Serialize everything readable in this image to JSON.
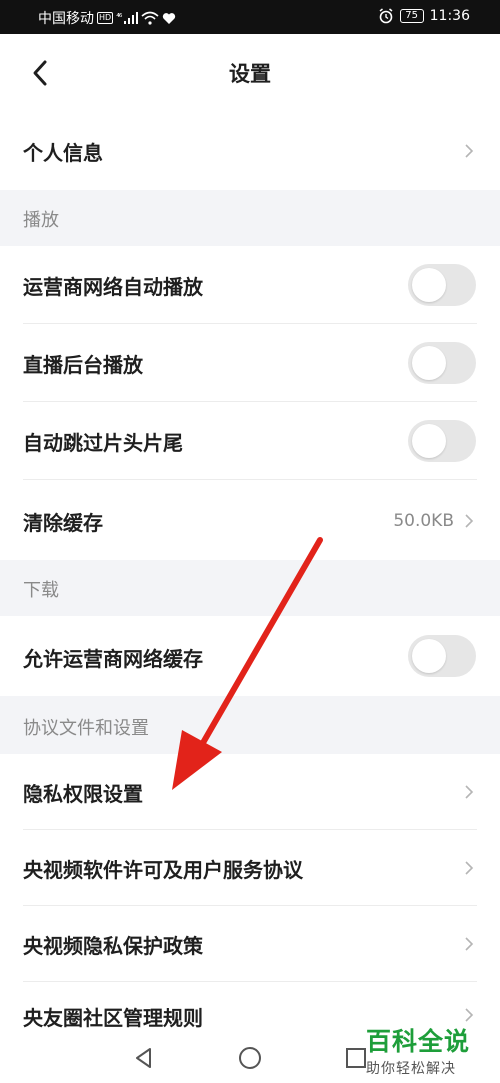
{
  "status_bar": {
    "carrier": "中国移动",
    "network_badge": "HD",
    "signal_label": "⁴⁶",
    "battery": "75",
    "time": "11:36"
  },
  "header": {
    "title": "设置"
  },
  "rows": {
    "personal_info": {
      "label": "个人信息"
    },
    "carrier_autoplay": {
      "label": "运营商网络自动播放",
      "enabled": false
    },
    "live_background": {
      "label": "直播后台播放",
      "enabled": false
    },
    "skip_intro": {
      "label": "自动跳过片头片尾",
      "enabled": false
    },
    "clear_cache": {
      "label": "清除缓存",
      "value": "50.0KB"
    },
    "allow_carrier_cache": {
      "label": "允许运营商网络缓存",
      "enabled": false
    },
    "privacy_permissions": {
      "label": "隐私权限设置"
    },
    "license_agreement": {
      "label": "央视频软件许可及用户服务协议"
    },
    "privacy_policy": {
      "label": "央视频隐私保护政策"
    },
    "community_rules": {
      "label": "央友圈社区管理规则"
    }
  },
  "sections": {
    "playback": "播放",
    "download": "下载",
    "agreements": "协议文件和设置"
  },
  "watermark": {
    "title": "百科全说",
    "subtitle": "助你轻松解决"
  },
  "colors": {
    "annotation_arrow": "#e2231a",
    "section_bg": "#f3f4f7",
    "toggle_off": "#e6e6e6",
    "watermark": "#1e9e3a"
  }
}
